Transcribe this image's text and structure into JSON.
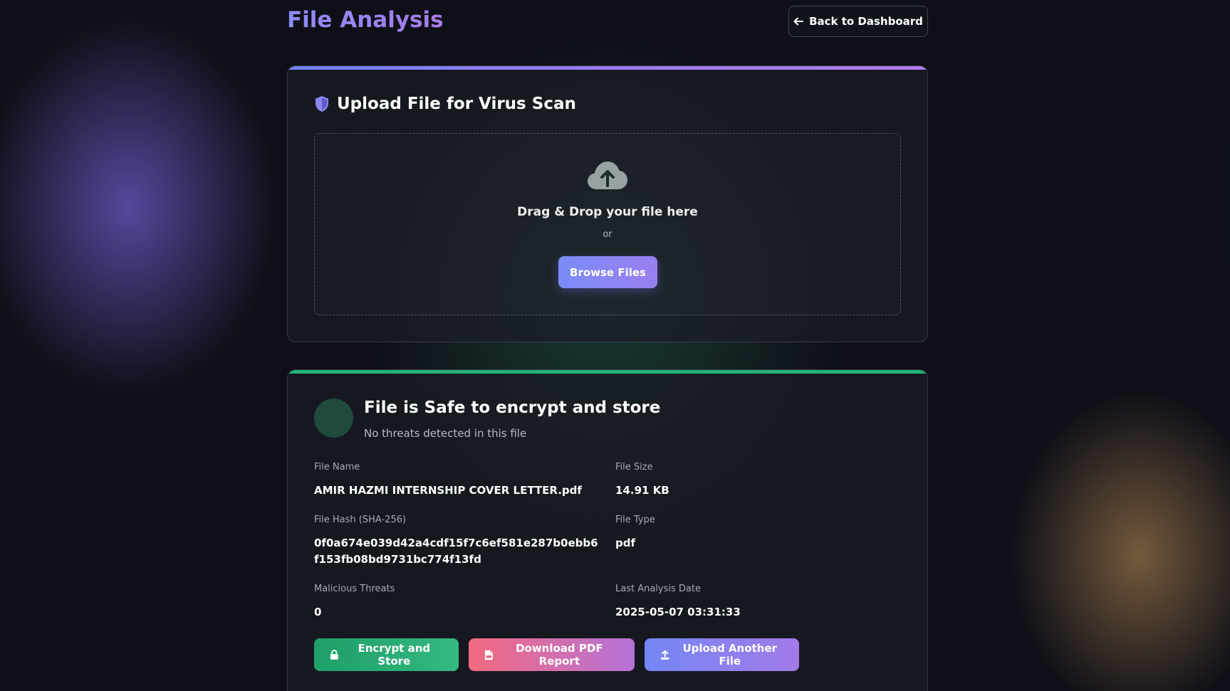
{
  "header": {
    "title": "File Analysis",
    "back_button": "Back to Dashboard"
  },
  "upload": {
    "title": "Upload File for Virus Scan",
    "drop_text": "Drag & Drop your file here",
    "or_text": "or",
    "browse_button": "Browse Files"
  },
  "result": {
    "title": "File is Safe to encrypt and store",
    "subtitle": "No threats detected in this file",
    "fields": {
      "file_name": {
        "label": "File Name",
        "value": "AMIR HAZMI INTERNSHIP COVER LETTER.pdf"
      },
      "file_size": {
        "label": "File Size",
        "value": "14.91 KB"
      },
      "file_hash": {
        "label": "File Hash (SHA-256)",
        "value": "0f0a674e039d42a4cdf15f7c6ef581e287b0ebb6f153fb08bd9731bc774f13fd"
      },
      "file_type": {
        "label": "File Type",
        "value": "pdf"
      },
      "malicious_threats": {
        "label": "Malicious Threats",
        "value": "0"
      },
      "last_analysis": {
        "label": "Last Analysis Date",
        "value": "2025-05-07 03:31:33"
      }
    },
    "actions": {
      "encrypt": "Encrypt and Store",
      "download_pdf": "Download PDF Report",
      "upload_another": "Upload Another File"
    }
  },
  "icons": {
    "back": "arrow-left-icon",
    "shield": "shield-icon",
    "cloud": "cloud-upload-icon",
    "lock": "lock-icon",
    "pdf": "file-pdf-icon",
    "upload": "upload-icon"
  },
  "colors": {
    "accent": "#8b8cf7",
    "safe": "#22b37a",
    "danger": "#f26a7e"
  }
}
